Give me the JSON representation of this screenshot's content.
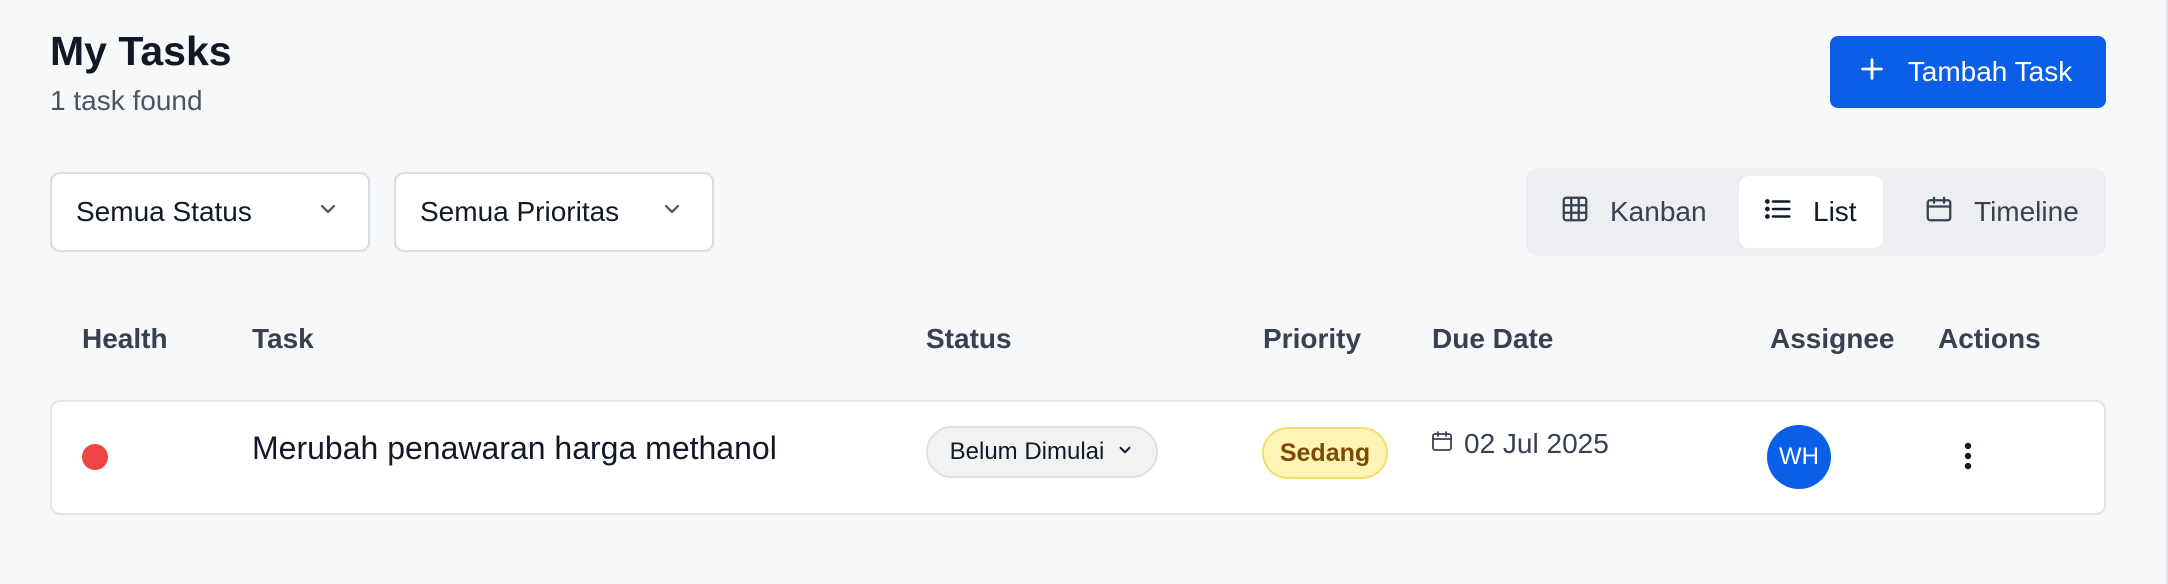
{
  "header": {
    "title": "My Tasks",
    "subtitle": "1 task found",
    "add_button_label": "Tambah Task"
  },
  "filters": {
    "status": {
      "selected": "Semua Status"
    },
    "priority": {
      "selected": "Semua Prioritas"
    }
  },
  "view_toggle": {
    "items": [
      {
        "label": "Kanban",
        "icon": "grid-icon"
      },
      {
        "label": "List",
        "icon": "list-icon",
        "active": true
      },
      {
        "label": "Timeline",
        "icon": "calendar-icon"
      }
    ]
  },
  "table": {
    "columns": [
      "Health",
      "Task",
      "Status",
      "Priority",
      "Due Date",
      "Assignee",
      "Actions"
    ],
    "rows": [
      {
        "health_color": "#ef4444",
        "task": "Merubah penawaran harga methanol",
        "status": "Belum Dimulai",
        "priority": "Sedang",
        "due_date": "02 Jul 2025",
        "assignee_initials": "WH"
      }
    ]
  },
  "colors": {
    "accent": "#0b5ee6",
    "health_red": "#ef4444",
    "priority_bg": "#fef4b5",
    "priority_text": "#7c4a03"
  }
}
